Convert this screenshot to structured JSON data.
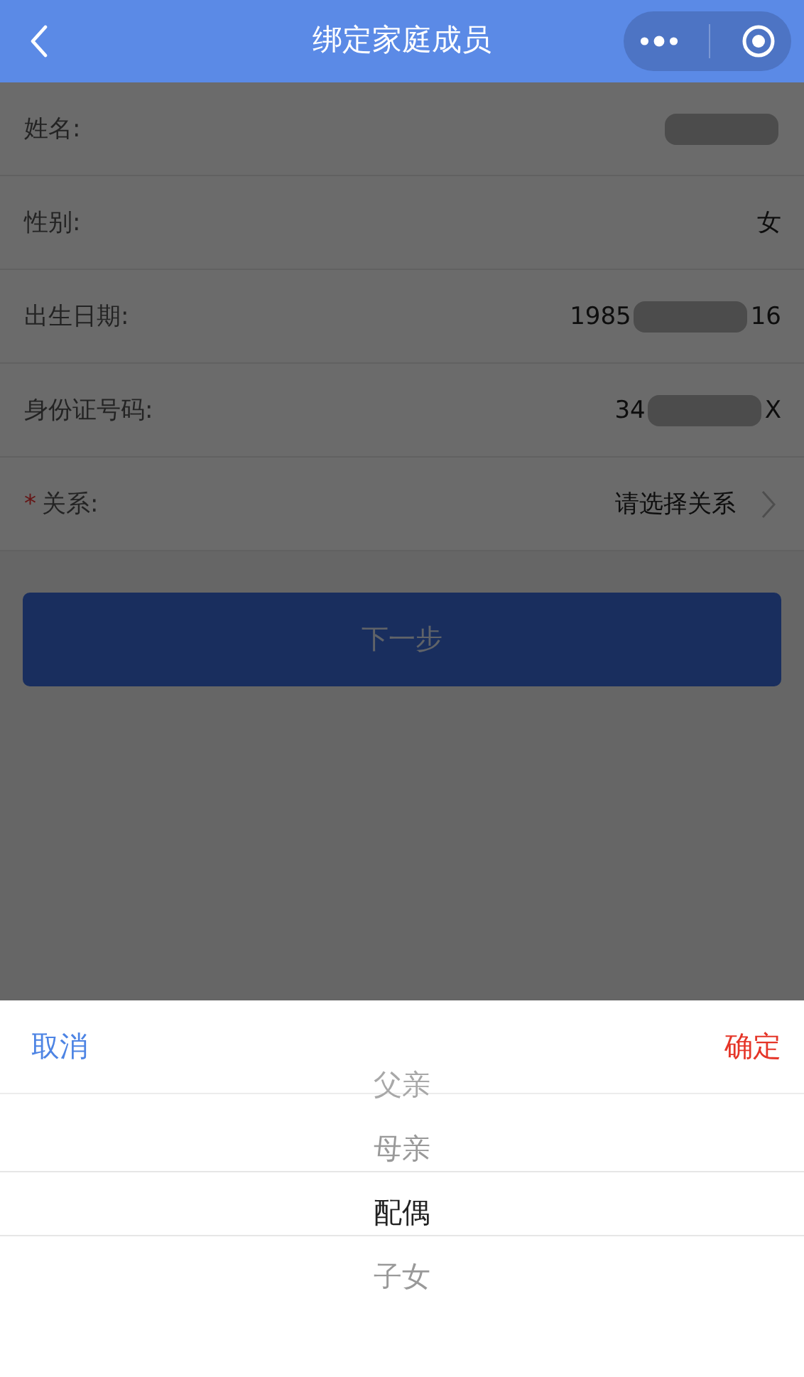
{
  "nav_bar": {
    "title": "绑定家庭成员"
  },
  "fields": [
    {
      "label": "姓名:",
      "redacted": true
    },
    {
      "label": "性别:",
      "value": "女"
    },
    {
      "label": "出生日期:",
      "prefix": "1985",
      "suffix": "16",
      "redacted": true
    },
    {
      "label": "身份证号码:",
      "prefix": "34",
      "suffix": "X",
      "redacted": true
    },
    {
      "label": "关系:",
      "required": true,
      "required_mark": "*",
      "placeholder": "请选择关系",
      "kind": "select"
    }
  ],
  "next_button": {
    "label": "下一步",
    "disabled": true
  },
  "picker": {
    "cancel": "取消",
    "confirm": "确定",
    "options": [
      {
        "label": "父亲",
        "selected": false
      },
      {
        "label": "母亲",
        "selected": false
      },
      {
        "label": "配偶",
        "selected": true
      },
      {
        "label": "子女",
        "selected": false
      }
    ]
  }
}
